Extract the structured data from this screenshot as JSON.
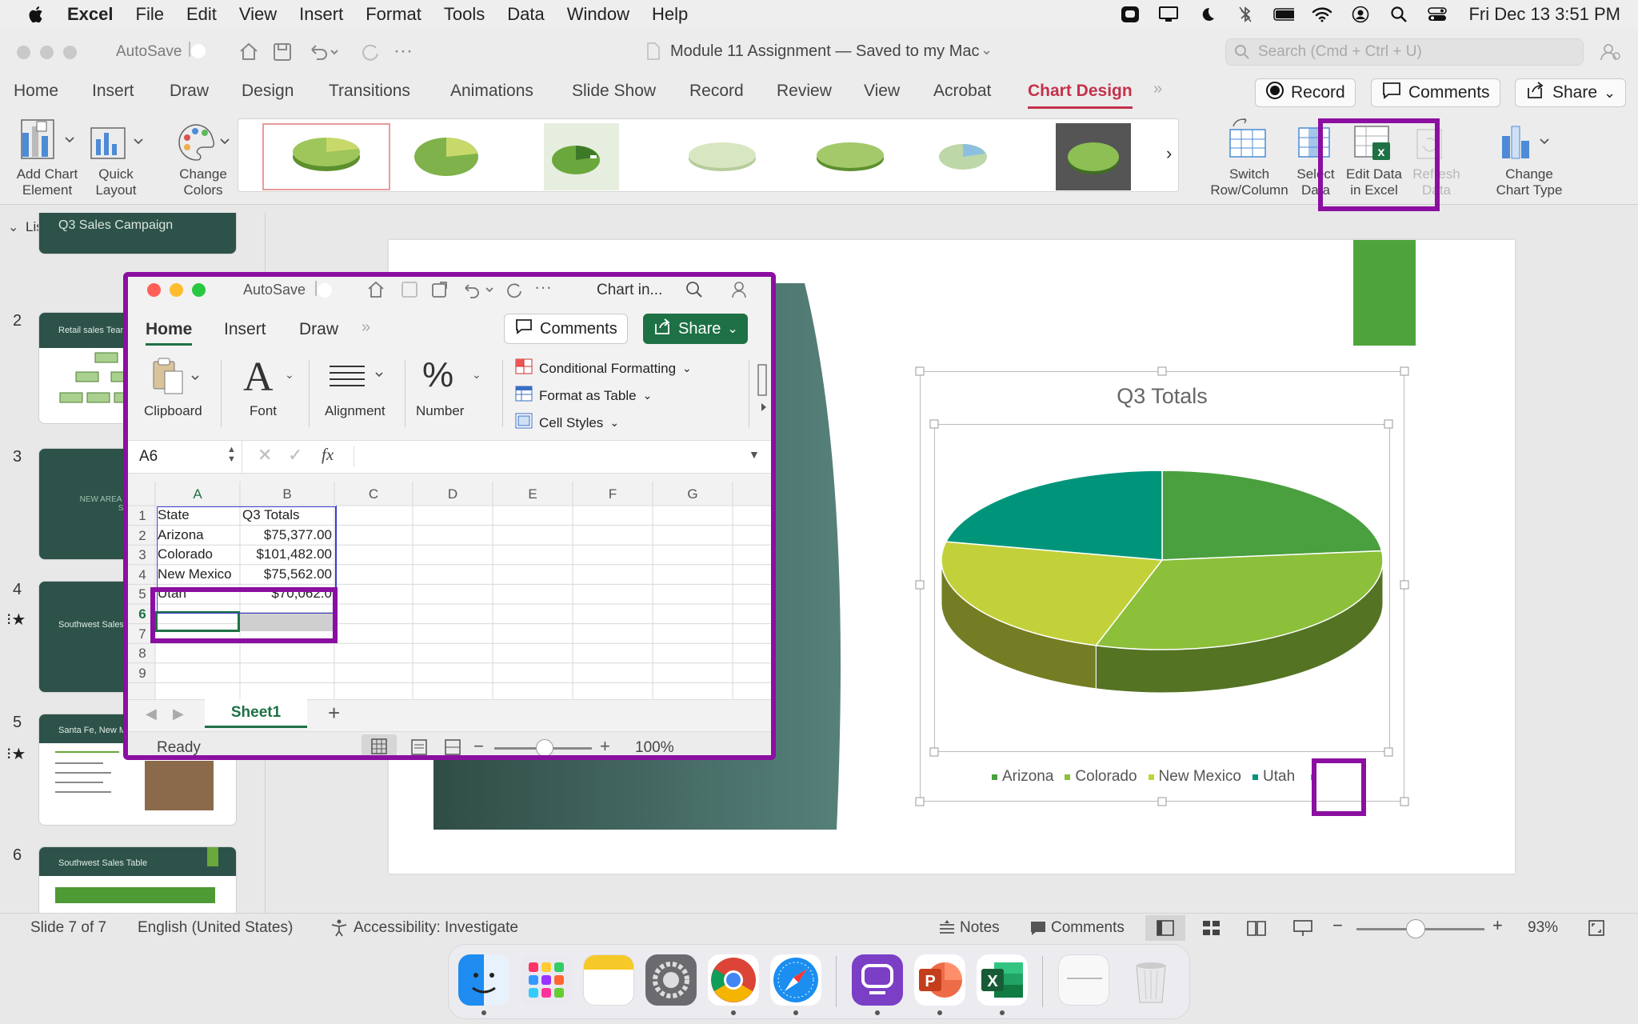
{
  "menubar": {
    "app_name": "Excel",
    "items": [
      "File",
      "Edit",
      "View",
      "Insert",
      "Format",
      "Tools",
      "Data",
      "Window",
      "Help"
    ],
    "datetime": "Fri Dec 13  3:51 PM"
  },
  "ppt": {
    "autosave_label": "AutoSave",
    "doc_title": "Module 11 Assignment — Saved to my Mac",
    "search_placeholder": "Search (Cmd + Ctrl + U)",
    "tabs": [
      "Home",
      "Insert",
      "Draw",
      "Design",
      "Transitions",
      "Animations",
      "Slide Show",
      "Record",
      "Review",
      "View",
      "Acrobat",
      "Chart Design"
    ],
    "active_tab": "Chart Design",
    "record_btn": "Record",
    "comments_btn": "Comments",
    "share_btn": "Share",
    "ribbon": {
      "add_chart_element": "Add Chart\nElement",
      "quick_layout": "Quick\nLayout",
      "change_colors": "Change\nColors",
      "switch_row_col": "Switch\nRow/Column",
      "select_data": "Select\nData",
      "edit_data_excel": "Edit Data\nin Excel",
      "refresh_data": "Refresh\nData",
      "change_chart_type": "Change\nChart Type"
    },
    "panel_header": "List",
    "slides": [
      {
        "num": "2",
        "title": "Retail sales Team",
        "star": false
      },
      {
        "num": "3",
        "title": "NEW AREA FOR COMPANY SALES",
        "star": false
      },
      {
        "num": "4",
        "title": "Southwest Sales",
        "star": true
      },
      {
        "num": "5",
        "title": "Santa Fe, New M",
        "star": true
      },
      {
        "num": "6",
        "title": "Southwest Sales Table",
        "star": false
      }
    ],
    "first_thumb_title": "Q3 Sales Campaign",
    "status": {
      "slide_of": "Slide 7 of 7",
      "language": "English (United States)",
      "accessibility": "Accessibility: Investigate",
      "notes": "Notes",
      "comments": "Comments",
      "zoom": "93%"
    }
  },
  "excel": {
    "autosave_label": "AutoSave",
    "title": "Chart in...",
    "tabs": [
      "Home",
      "Insert",
      "Draw"
    ],
    "comments_btn": "Comments",
    "share_btn": "Share",
    "ribbon": {
      "clipboard": "Clipboard",
      "font": "Font",
      "alignment": "Alignment",
      "number": "Number",
      "conditional_formatting": "Conditional Formatting",
      "format_as_table": "Format as Table",
      "cell_styles": "Cell Styles"
    },
    "name_box": "A6",
    "fx": "fx",
    "columns": [
      "A",
      "B",
      "C",
      "D",
      "E",
      "F",
      "G"
    ],
    "rows": [
      "1",
      "2",
      "3",
      "4",
      "5",
      "6",
      "7",
      "8",
      "9"
    ],
    "cells": [
      [
        "State",
        "Q3 Totals"
      ],
      [
        "Arizona",
        "$75,377.00"
      ],
      [
        "Colorado",
        "$101,482.00"
      ],
      [
        "New Mexico",
        "$75,562.00"
      ],
      [
        "Utah",
        "$70,062.0"
      ]
    ],
    "sheet_tab": "Sheet1",
    "status": "Ready",
    "zoom": "100%"
  },
  "chart_data": {
    "type": "pie",
    "title": "Q3 Totals",
    "categories": [
      "Arizona",
      "Colorado",
      "New Mexico",
      "Utah"
    ],
    "values": [
      75377,
      101482,
      75562,
      70062
    ],
    "colors": [
      "#4aa03f",
      "#8cbf3a",
      "#c2d13a",
      "#00957a"
    ],
    "legend_position": "bottom",
    "three_d": true
  },
  "colors": {
    "accent_ppt": "#c4314b",
    "excel_green": "#1e7145",
    "highlight_purple": "#8b0fa0"
  }
}
